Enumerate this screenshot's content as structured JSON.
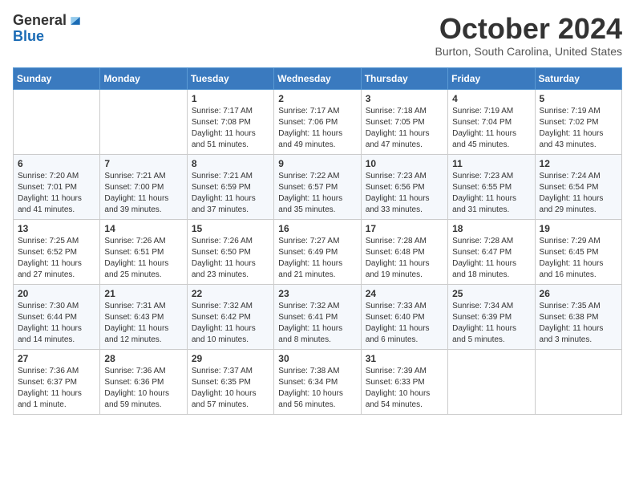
{
  "header": {
    "logo_general": "General",
    "logo_blue": "Blue",
    "month_title": "October 2024",
    "location": "Burton, South Carolina, United States"
  },
  "weekdays": [
    "Sunday",
    "Monday",
    "Tuesday",
    "Wednesday",
    "Thursday",
    "Friday",
    "Saturday"
  ],
  "weeks": [
    [
      {
        "day": "",
        "info": ""
      },
      {
        "day": "",
        "info": ""
      },
      {
        "day": "1",
        "info": "Sunrise: 7:17 AM\nSunset: 7:08 PM\nDaylight: 11 hours and 51 minutes."
      },
      {
        "day": "2",
        "info": "Sunrise: 7:17 AM\nSunset: 7:06 PM\nDaylight: 11 hours and 49 minutes."
      },
      {
        "day": "3",
        "info": "Sunrise: 7:18 AM\nSunset: 7:05 PM\nDaylight: 11 hours and 47 minutes."
      },
      {
        "day": "4",
        "info": "Sunrise: 7:19 AM\nSunset: 7:04 PM\nDaylight: 11 hours and 45 minutes."
      },
      {
        "day": "5",
        "info": "Sunrise: 7:19 AM\nSunset: 7:02 PM\nDaylight: 11 hours and 43 minutes."
      }
    ],
    [
      {
        "day": "6",
        "info": "Sunrise: 7:20 AM\nSunset: 7:01 PM\nDaylight: 11 hours and 41 minutes."
      },
      {
        "day": "7",
        "info": "Sunrise: 7:21 AM\nSunset: 7:00 PM\nDaylight: 11 hours and 39 minutes."
      },
      {
        "day": "8",
        "info": "Sunrise: 7:21 AM\nSunset: 6:59 PM\nDaylight: 11 hours and 37 minutes."
      },
      {
        "day": "9",
        "info": "Sunrise: 7:22 AM\nSunset: 6:57 PM\nDaylight: 11 hours and 35 minutes."
      },
      {
        "day": "10",
        "info": "Sunrise: 7:23 AM\nSunset: 6:56 PM\nDaylight: 11 hours and 33 minutes."
      },
      {
        "day": "11",
        "info": "Sunrise: 7:23 AM\nSunset: 6:55 PM\nDaylight: 11 hours and 31 minutes."
      },
      {
        "day": "12",
        "info": "Sunrise: 7:24 AM\nSunset: 6:54 PM\nDaylight: 11 hours and 29 minutes."
      }
    ],
    [
      {
        "day": "13",
        "info": "Sunrise: 7:25 AM\nSunset: 6:52 PM\nDaylight: 11 hours and 27 minutes."
      },
      {
        "day": "14",
        "info": "Sunrise: 7:26 AM\nSunset: 6:51 PM\nDaylight: 11 hours and 25 minutes."
      },
      {
        "day": "15",
        "info": "Sunrise: 7:26 AM\nSunset: 6:50 PM\nDaylight: 11 hours and 23 minutes."
      },
      {
        "day": "16",
        "info": "Sunrise: 7:27 AM\nSunset: 6:49 PM\nDaylight: 11 hours and 21 minutes."
      },
      {
        "day": "17",
        "info": "Sunrise: 7:28 AM\nSunset: 6:48 PM\nDaylight: 11 hours and 19 minutes."
      },
      {
        "day": "18",
        "info": "Sunrise: 7:28 AM\nSunset: 6:47 PM\nDaylight: 11 hours and 18 minutes."
      },
      {
        "day": "19",
        "info": "Sunrise: 7:29 AM\nSunset: 6:45 PM\nDaylight: 11 hours and 16 minutes."
      }
    ],
    [
      {
        "day": "20",
        "info": "Sunrise: 7:30 AM\nSunset: 6:44 PM\nDaylight: 11 hours and 14 minutes."
      },
      {
        "day": "21",
        "info": "Sunrise: 7:31 AM\nSunset: 6:43 PM\nDaylight: 11 hours and 12 minutes."
      },
      {
        "day": "22",
        "info": "Sunrise: 7:32 AM\nSunset: 6:42 PM\nDaylight: 11 hours and 10 minutes."
      },
      {
        "day": "23",
        "info": "Sunrise: 7:32 AM\nSunset: 6:41 PM\nDaylight: 11 hours and 8 minutes."
      },
      {
        "day": "24",
        "info": "Sunrise: 7:33 AM\nSunset: 6:40 PM\nDaylight: 11 hours and 6 minutes."
      },
      {
        "day": "25",
        "info": "Sunrise: 7:34 AM\nSunset: 6:39 PM\nDaylight: 11 hours and 5 minutes."
      },
      {
        "day": "26",
        "info": "Sunrise: 7:35 AM\nSunset: 6:38 PM\nDaylight: 11 hours and 3 minutes."
      }
    ],
    [
      {
        "day": "27",
        "info": "Sunrise: 7:36 AM\nSunset: 6:37 PM\nDaylight: 11 hours and 1 minute."
      },
      {
        "day": "28",
        "info": "Sunrise: 7:36 AM\nSunset: 6:36 PM\nDaylight: 10 hours and 59 minutes."
      },
      {
        "day": "29",
        "info": "Sunrise: 7:37 AM\nSunset: 6:35 PM\nDaylight: 10 hours and 57 minutes."
      },
      {
        "day": "30",
        "info": "Sunrise: 7:38 AM\nSunset: 6:34 PM\nDaylight: 10 hours and 56 minutes."
      },
      {
        "day": "31",
        "info": "Sunrise: 7:39 AM\nSunset: 6:33 PM\nDaylight: 10 hours and 54 minutes."
      },
      {
        "day": "",
        "info": ""
      },
      {
        "day": "",
        "info": ""
      }
    ]
  ]
}
